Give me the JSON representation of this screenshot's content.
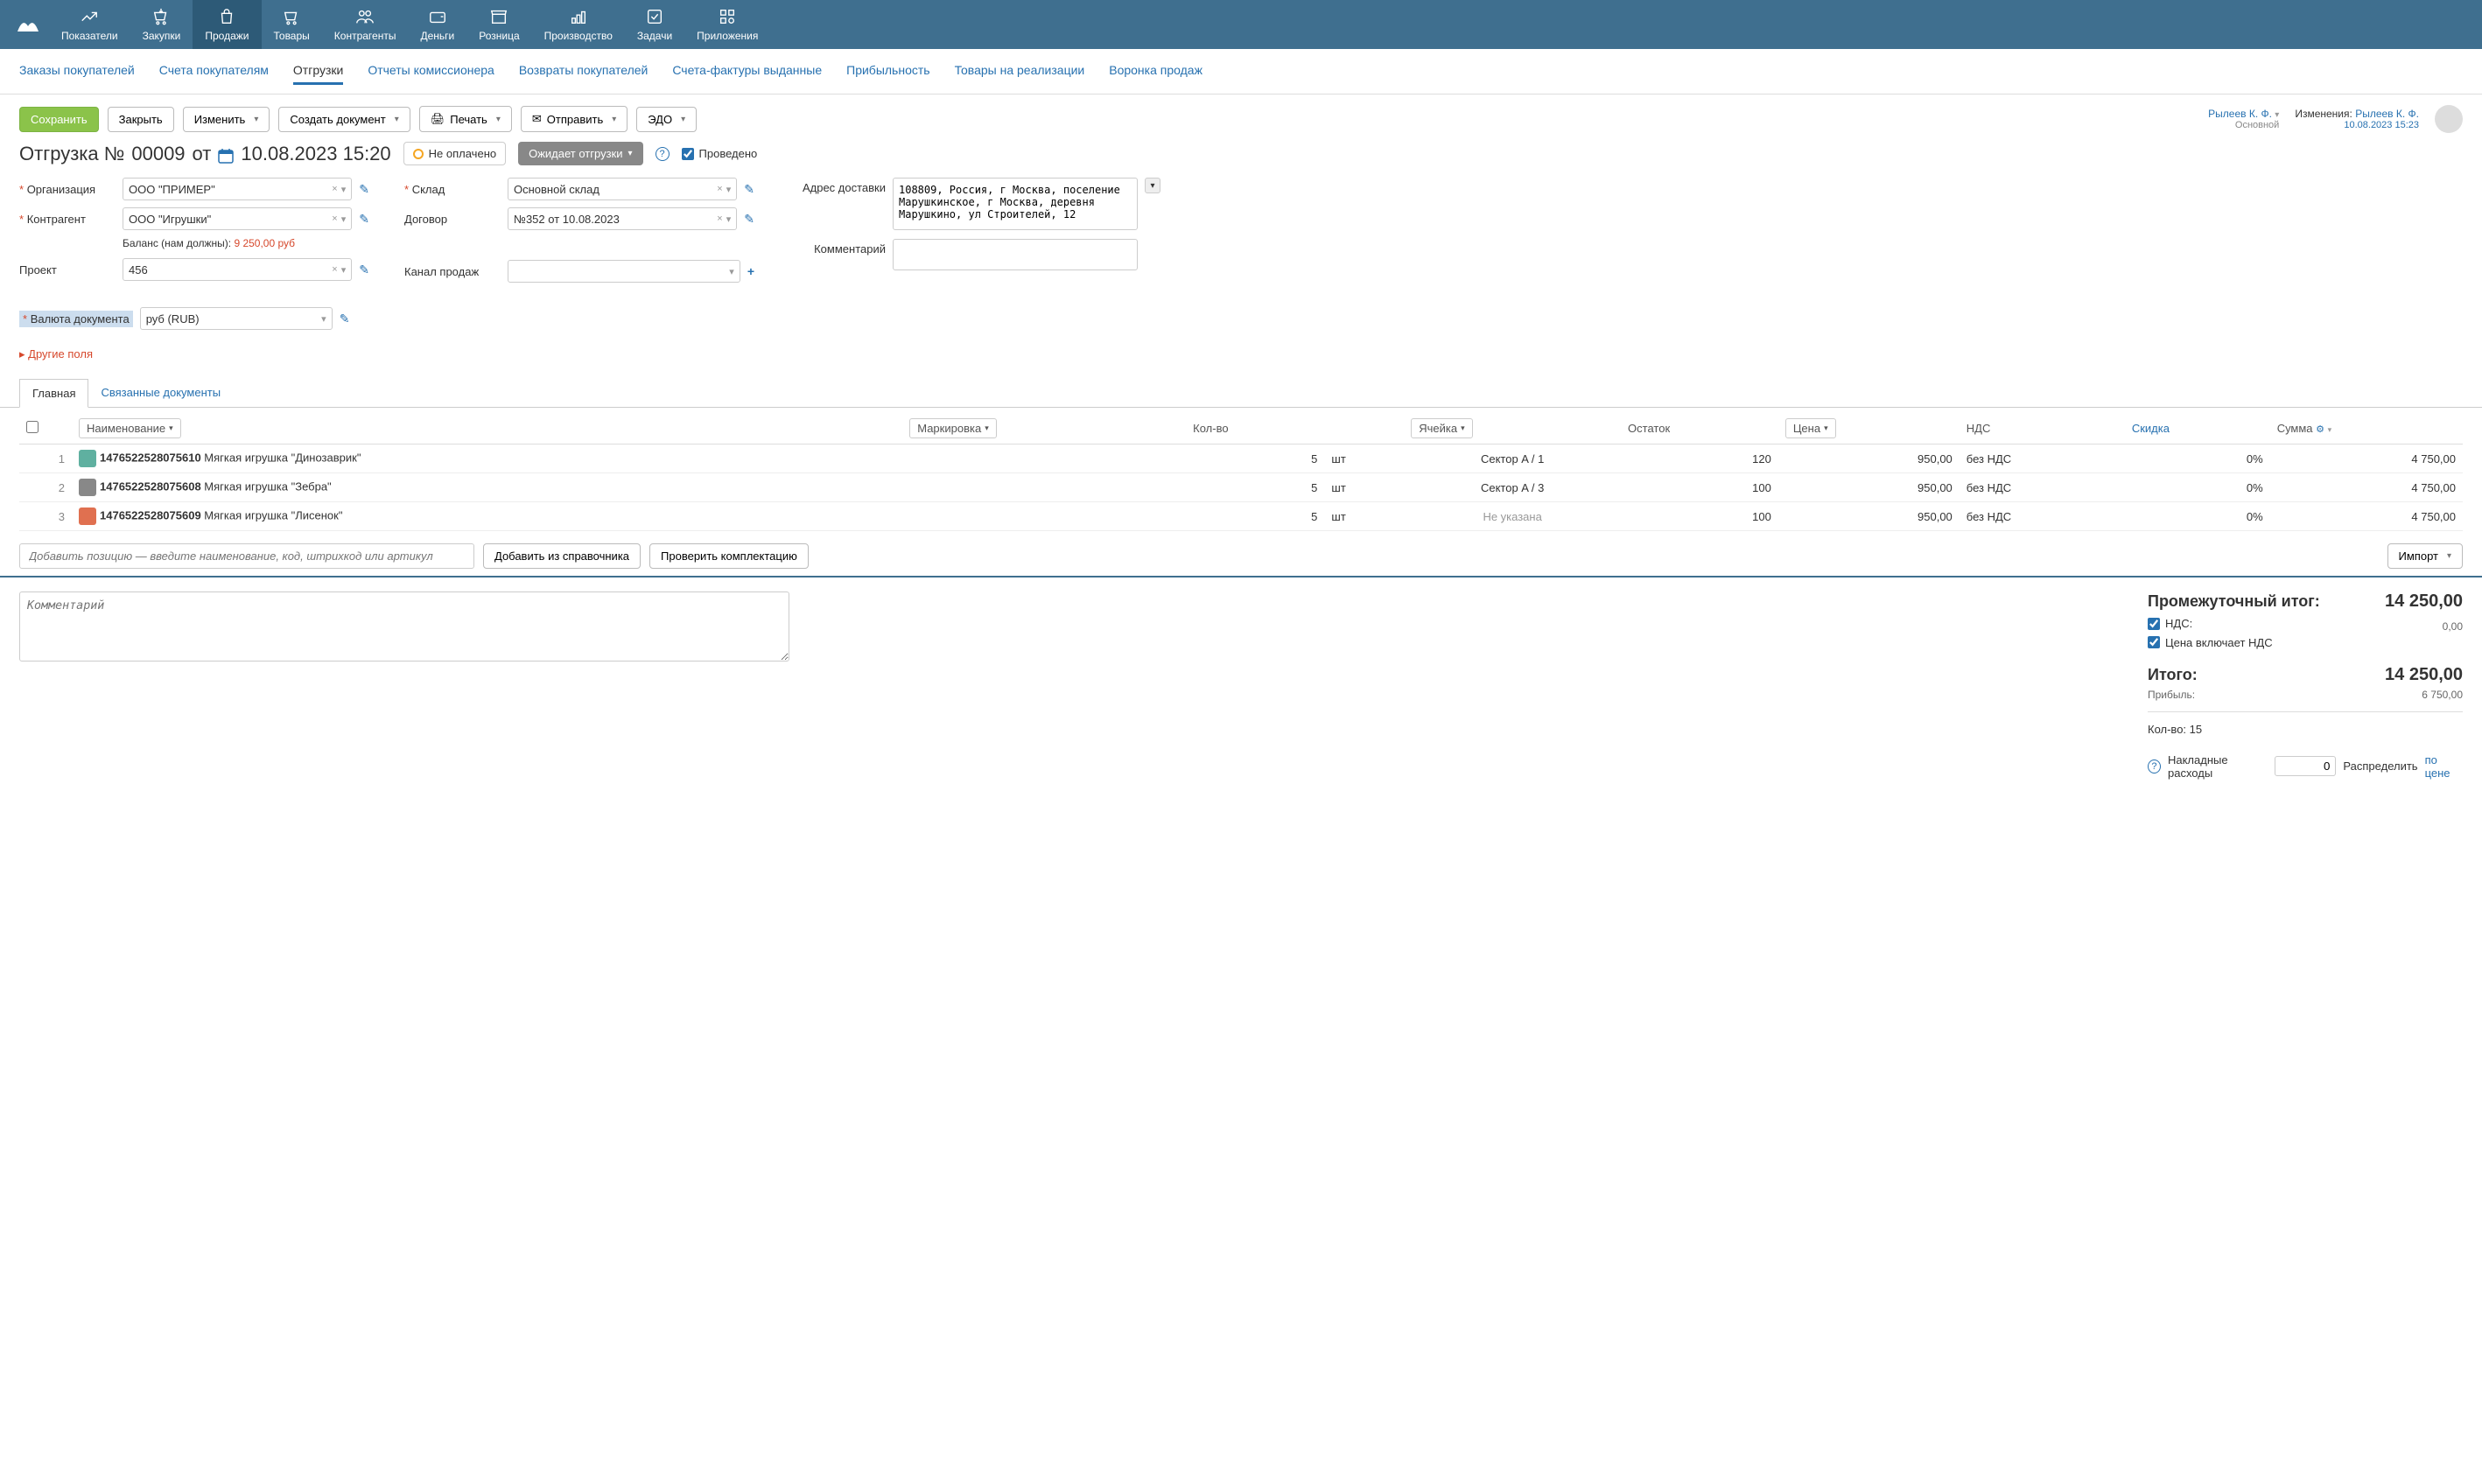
{
  "topnav": {
    "items": [
      {
        "label": "Показатели",
        "icon": "chart"
      },
      {
        "label": "Закупки",
        "icon": "cart-in"
      },
      {
        "label": "Продажи",
        "icon": "bag",
        "active": true
      },
      {
        "label": "Товары",
        "icon": "cart"
      },
      {
        "label": "Контрагенты",
        "icon": "people"
      },
      {
        "label": "Деньги",
        "icon": "wallet"
      },
      {
        "label": "Розница",
        "icon": "store"
      },
      {
        "label": "Производство",
        "icon": "factory"
      },
      {
        "label": "Задачи",
        "icon": "check"
      },
      {
        "label": "Приложения",
        "icon": "apps"
      }
    ]
  },
  "subtabs": {
    "items": [
      "Заказы покупателей",
      "Счета покупателям",
      "Отгрузки",
      "Отчеты комиссионера",
      "Возвраты покупателей",
      "Счета-фактуры выданные",
      "Прибыльность",
      "Товары на реализации",
      "Воронка продаж"
    ],
    "active_index": 2
  },
  "toolbar": {
    "save": "Сохранить",
    "close": "Закрыть",
    "edit": "Изменить",
    "create_doc": "Создать документ",
    "print": "Печать",
    "send": "Отправить",
    "edo": "ЭДО",
    "user": {
      "name": "Рылеев К. Ф.",
      "sub": "Основной"
    },
    "changes_label": "Изменения:",
    "changes_user": "Рылеев К. Ф.",
    "changes_time": "10.08.2023 15:23"
  },
  "doc": {
    "title_prefix": "Отгрузка №",
    "number": "00009",
    "from": "от",
    "datetime": "10.08.2023 15:20",
    "payment_status": "Не оплачено",
    "shipment_status": "Ожидает отгрузки",
    "posted_label": "Проведено"
  },
  "form": {
    "org_label": "Организация",
    "org_value": "ООО \"ПРИМЕР\"",
    "counterparty_label": "Контрагент",
    "counterparty_value": "ООО \"Игрушки\"",
    "balance_label": "Баланс (нам должны):",
    "balance_value": "9 250,00 руб",
    "project_label": "Проект",
    "project_value": "456",
    "currency_label": "Валюта документа",
    "currency_value": "руб (RUB)",
    "warehouse_label": "Склад",
    "warehouse_value": "Основной склад",
    "contract_label": "Договор",
    "contract_value": "№352 от 10.08.2023",
    "channel_label": "Канал продаж",
    "channel_value": "",
    "address_label": "Адрес доставки",
    "address_value": "108809, Россия, г Москва, поселение Марушкинское, г Москва, деревня Марушкино, ул Строителей, 12",
    "comment_label": "Комментарий",
    "other_fields": "Другие поля"
  },
  "doc_tabs": {
    "main": "Главная",
    "related": "Связанные документы"
  },
  "table": {
    "headers": {
      "name": "Наименование",
      "marking": "Маркировка",
      "qty": "Кол-во",
      "cell": "Ячейка",
      "stock": "Остаток",
      "price": "Цена",
      "vat": "НДС",
      "discount": "Скидка",
      "sum": "Сумма"
    },
    "rows": [
      {
        "n": "1",
        "code": "14765225280756­10",
        "name": "Мягкая игрушка \"Динозаврик\"",
        "qty": "5",
        "unit": "шт",
        "cell": "Сектор A / 1",
        "stock": "120",
        "price": "950,00",
        "vat": "без НДС",
        "discount": "0%",
        "sum": "4 750,00",
        "color": "#5fb0a0"
      },
      {
        "n": "2",
        "code": "14765225280756­08",
        "name": "Мягкая игрушка \"Зебра\"",
        "qty": "5",
        "unit": "шт",
        "cell": "Сектор A / 3",
        "stock": "100",
        "price": "950,00",
        "vat": "без НДС",
        "discount": "0%",
        "sum": "4 750,00",
        "color": "#888"
      },
      {
        "n": "3",
        "code": "14765225280756­09",
        "name": "Мягкая игрушка \"Лисенок\"",
        "qty": "5",
        "unit": "шт",
        "cell": "Не указана",
        "cell_gray": true,
        "stock": "100",
        "price": "950,00",
        "vat": "без НДС",
        "discount": "0%",
        "sum": "4 750,00",
        "color": "#e07050"
      }
    ],
    "add_placeholder": "Добавить позицию — введите наименование, код, штрихкод или артикул",
    "add_from_ref": "Добавить из справочника",
    "check_kit": "Проверить комплектацию",
    "import": "Импорт"
  },
  "bottom": {
    "comment_placeholder": "Комментарий",
    "subtotal_label": "Промежуточный итог:",
    "subtotal_value": "14 250,00",
    "vat_chk": "НДС:",
    "vat_value": "0,00",
    "price_incl_vat": "Цена включает НДС",
    "total_label": "Итого:",
    "total_value": "14 250,00",
    "profit_label": "Прибыль:",
    "profit_value": "6 750,00",
    "qty_label": "Кол-во: 15",
    "overhead_label": "Накладные расходы",
    "overhead_value": "0",
    "distribute_label": "Распределить",
    "by_price": "по цене"
  }
}
